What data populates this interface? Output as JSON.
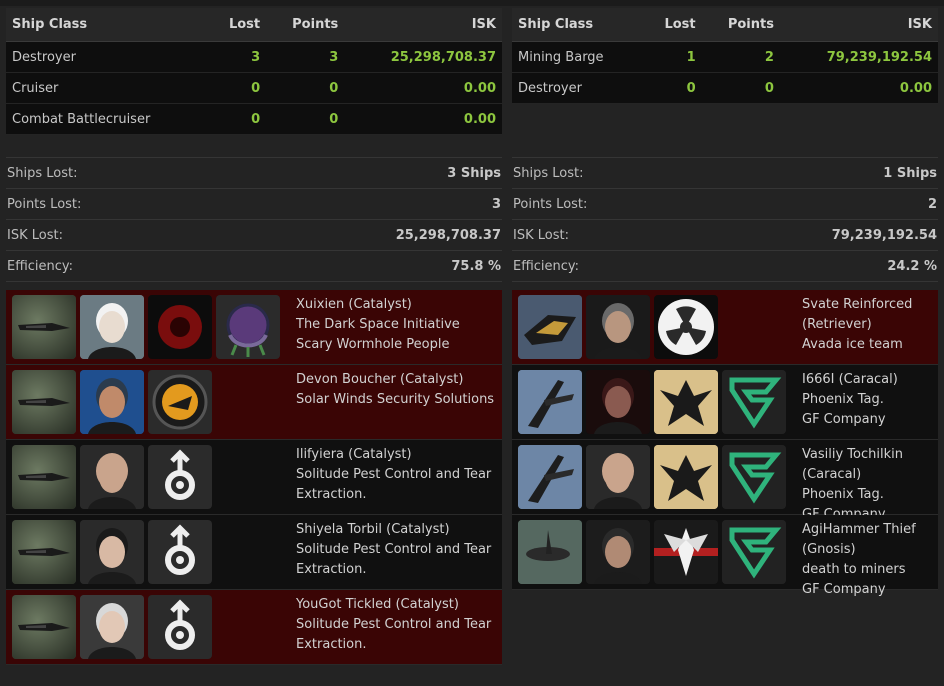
{
  "table_headers": {
    "ship_class": "Ship Class",
    "lost": "Lost",
    "points": "Points",
    "isk": "ISK"
  },
  "left": {
    "ships": [
      {
        "class": "Destroyer",
        "lost": "3",
        "points": "3",
        "isk": "25,298,708.37"
      },
      {
        "class": "Cruiser",
        "lost": "0",
        "points": "0",
        "isk": "0.00"
      },
      {
        "class": "Combat Battlecruiser",
        "lost": "0",
        "points": "0",
        "isk": "0.00"
      }
    ],
    "stats": [
      {
        "label": "Ships Lost:",
        "value": "3 Ships"
      },
      {
        "label": "Points Lost:",
        "value": "3"
      },
      {
        "label": "ISK Lost:",
        "value": "25,298,708.37"
      },
      {
        "label": "Efficiency:",
        "value": "75.8 %"
      }
    ],
    "pilots": [
      {
        "lines": [
          "Xuixien (Catalyst)",
          "The Dark Space Initiative",
          "Scary Wormhole People"
        ],
        "highlight": true
      },
      {
        "lines": [
          "Devon Boucher (Catalyst)",
          "Solar Winds Security Solutions"
        ],
        "highlight": true
      },
      {
        "lines": [
          "Ilifyiera (Catalyst)",
          "Solitude Pest Control and Tear Extraction."
        ],
        "highlight": false
      },
      {
        "lines": [
          "Shiyela Torbil (Catalyst)",
          "Solitude Pest Control and Tear Extraction."
        ],
        "highlight": false
      },
      {
        "lines": [
          "YouGot Tickled (Catalyst)",
          "Solitude Pest Control and Tear Extraction."
        ],
        "highlight": true
      }
    ]
  },
  "right": {
    "ships": [
      {
        "class": "Mining Barge",
        "lost": "1",
        "points": "2",
        "isk": "79,239,192.54"
      },
      {
        "class": "Destroyer",
        "lost": "0",
        "points": "0",
        "isk": "0.00"
      }
    ],
    "stats": [
      {
        "label": "Ships Lost:",
        "value": "1 Ships"
      },
      {
        "label": "Points Lost:",
        "value": "2"
      },
      {
        "label": "ISK Lost:",
        "value": "79,239,192.54"
      },
      {
        "label": "Efficiency:",
        "value": "24.2 %"
      }
    ],
    "pilots": [
      {
        "lines": [
          "Svate Reinforced (Retriever)",
          "Avada ice team"
        ],
        "highlight": true
      },
      {
        "lines": [
          "I666I (Caracal)",
          "Phoenix Tag.",
          "GF Company"
        ],
        "highlight": false
      },
      {
        "lines": [
          "Vasiliy Tochilkin (Caracal)",
          "Phoenix Tag.",
          "GF Company"
        ],
        "highlight": false
      },
      {
        "lines": [
          "AgiHammer Thief (Gnosis)",
          "death to miners",
          "GF Company"
        ],
        "highlight": false
      }
    ]
  },
  "images": {
    "left": [
      [
        "ship-catalyst",
        "portrait-white-hair",
        "corp-logo-red-orb",
        "alliance-logo-tentacle"
      ],
      [
        "ship-catalyst",
        "portrait-sunglasses-man",
        "corp-logo-solar-winds"
      ],
      [
        "ship-catalyst",
        "portrait-bald-sunglasses",
        "corp-logo-male-symbol"
      ],
      [
        "ship-catalyst",
        "portrait-dark-hair-woman",
        "corp-logo-male-symbol"
      ],
      [
        "ship-catalyst",
        "portrait-grey-hair-woman",
        "corp-logo-male-symbol"
      ]
    ],
    "right": [
      [
        "ship-retriever",
        "portrait-man-sunglasses",
        "corp-logo-radiation"
      ],
      [
        "ship-caracal",
        "portrait-hooded",
        "corp-logo-phoenix",
        "alliance-logo-gf-company"
      ],
      [
        "ship-caracal",
        "portrait-bald-sunglasses",
        "corp-logo-phoenix",
        "alliance-logo-gf-company"
      ],
      [
        "ship-gnosis",
        "portrait-armored-man",
        "corp-logo-winged-emblem",
        "alliance-logo-gf-company"
      ]
    ]
  },
  "colors": {
    "positive": "#8dc63f",
    "highlight_row": "#3a0505",
    "gf_green": "#2fb37c"
  }
}
